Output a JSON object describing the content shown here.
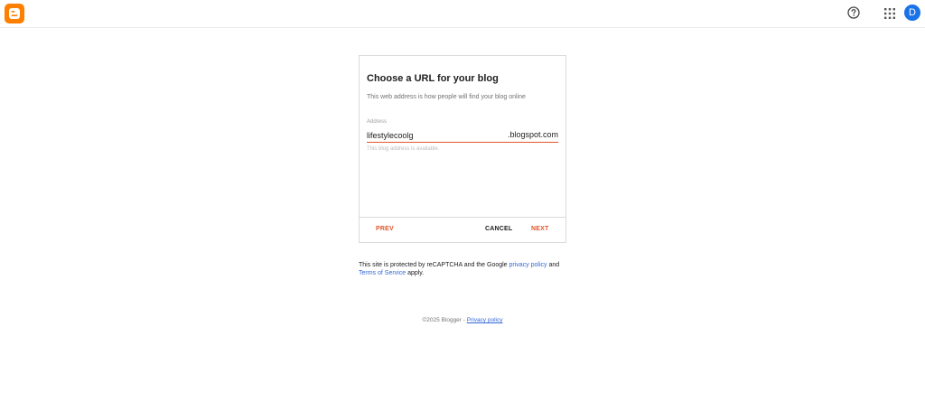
{
  "header": {
    "avatar_initial": "D",
    "brand_color": "#ff8000",
    "logo_icon": "blogger-logo-icon",
    "help_icon": "help-icon",
    "apps_icon": "apps-grid-icon"
  },
  "card": {
    "title": "Choose a URL for your blog",
    "subtitle": "This web address is how people will find your blog online",
    "field": {
      "label": "Address",
      "value": "lifestylecoolg",
      "placeholder": "",
      "suffix": ".blogspot.com",
      "helper": "This blog address is available."
    },
    "buttons": {
      "prev": "PREV",
      "cancel": "CANCEL",
      "next": "NEXT"
    },
    "accent_color": "#e0572b"
  },
  "legal": {
    "text_before": "This site is protected by reCAPTCHA and the Google ",
    "privacy_link": "privacy policy",
    "text_and": " and ",
    "terms_link": "Terms of Service",
    "text_after": " apply."
  },
  "footer": {
    "copyright": "©2025 Blogger - ",
    "privacy_link": "Privacy policy"
  }
}
